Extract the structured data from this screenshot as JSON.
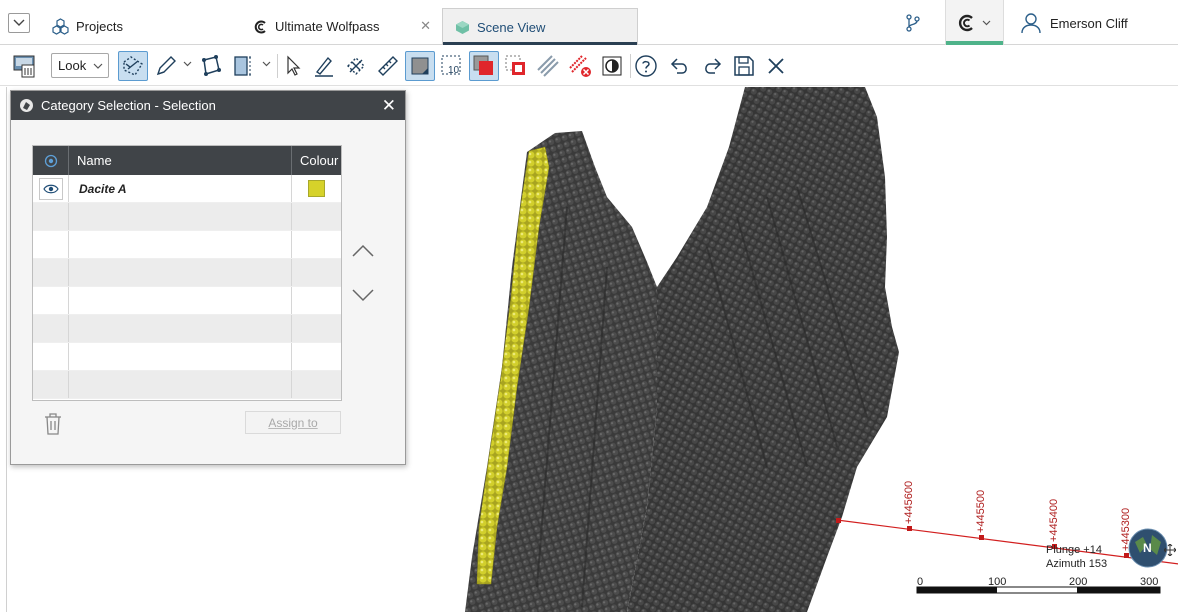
{
  "tabs": {
    "projects": "Projects",
    "project_name": "Ultimate Wolfpass",
    "scene": "Scene View",
    "close_glyph": "✕"
  },
  "user": {
    "name": "Emerson Cliff"
  },
  "toolbar": {
    "view_mode": "Look",
    "icons": [
      "erase-all-icon",
      "slice-icon",
      "pencil-icon",
      "polyline-icon",
      "plane-icon",
      "select-arrow-icon",
      "draw-line-icon",
      "polygon-icon",
      "ruler-icon",
      "box-select-icon",
      "grid-10-icon",
      "red-select-icon",
      "red-deselect-icon",
      "hatch-icon",
      "hatch-remove-icon",
      "contrast-icon",
      "help-icon",
      "undo-icon",
      "redo-icon",
      "save-icon",
      "close-icon",
      "camera-icon"
    ]
  },
  "dialog": {
    "title": "Category Selection - Selection",
    "columns": {
      "name": "Name",
      "colour": "Colour"
    },
    "rows": [
      {
        "name": "Dacite A",
        "colour": "#d6d22a",
        "visible": true
      }
    ],
    "assign_label": "Assign to"
  },
  "scene": {
    "plunge": "Plunge +14",
    "azimuth": "Azimuth 153",
    "north_label": "N",
    "scale": [
      "0",
      "100",
      "200",
      "300"
    ],
    "northings": [
      "+445600",
      "+445500",
      "+445400",
      "+445300"
    ],
    "selected_colour": "#d2cf2c",
    "body_colour": "#3b3b3b"
  }
}
